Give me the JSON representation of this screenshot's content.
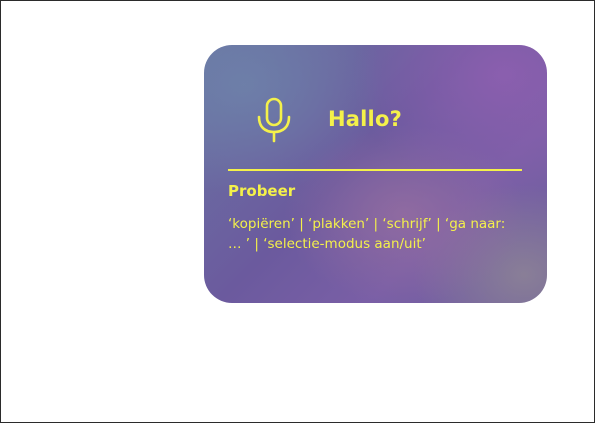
{
  "voice_panel": {
    "icon": "microphone-icon",
    "greeting": "Hallo?",
    "try_label": "Probeer",
    "hint": "‘kopiëren’ | ‘plakken’ | ‘schrijf’ | ‘ga naar:  … ’ | ‘selectie-modus aan/uit’"
  },
  "colors": {
    "accent": "#f4f14a",
    "card_base": "#6b5a9e"
  }
}
